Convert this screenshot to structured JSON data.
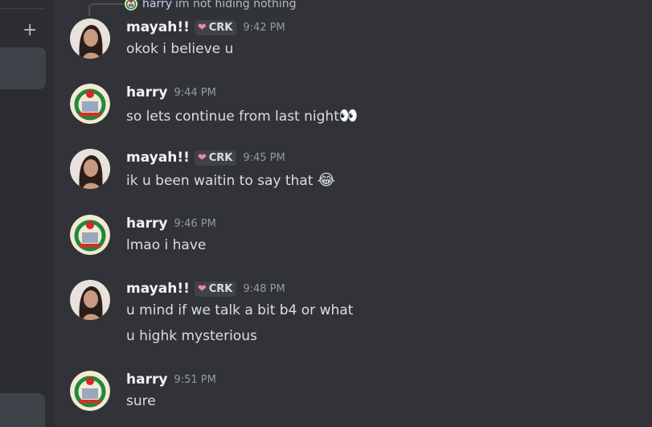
{
  "sidebar": {
    "add_icon": "plus-icon",
    "add_label": "+"
  },
  "reply": {
    "name": "harry",
    "text": "im not hiding nothing"
  },
  "messages": [
    {
      "author": "mayah!!",
      "tag": "CRK",
      "time": "9:42 PM",
      "lines": [
        "okok i believe u"
      ]
    },
    {
      "author": "harry",
      "time": "9:44 PM",
      "lines": [
        "so lets continue from last night"
      ],
      "emoji": "👀"
    },
    {
      "author": "mayah!!",
      "tag": "CRK",
      "time": "9:45 PM",
      "lines": [
        "ik u been waitin to say that "
      ],
      "emoji": "😂"
    },
    {
      "author": "harry",
      "time": "9:46 PM",
      "lines": [
        "lmao i have"
      ]
    },
    {
      "author": "mayah!!",
      "tag": "CRK",
      "time": "9:48 PM",
      "lines": [
        "u mind if we talk a bit b4 or what",
        "u highk mysterious"
      ]
    },
    {
      "author": "harry",
      "time": "9:51 PM",
      "lines": [
        "sure"
      ]
    }
  ],
  "colors": {
    "background": "#313338",
    "sidebar": "#2b2d31",
    "name": "#f2f3f5",
    "timestamp": "#949ba4"
  }
}
